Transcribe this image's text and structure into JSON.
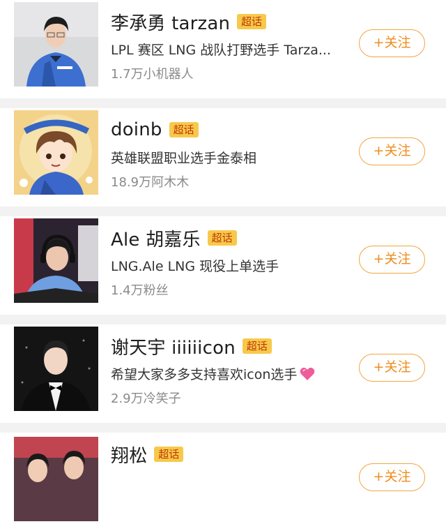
{
  "accounts": [
    {
      "name": "李承勇 tarzan",
      "badge": "超话",
      "desc": "LPL 赛区 LNG 战队打野选手 Tarza...",
      "fans": "1.7万小机器人",
      "follow": "+关注",
      "avatar_icon": "player-photo-jersey"
    },
    {
      "name": "doinb",
      "badge": "超话",
      "desc": "英雄联盟职业选手金泰相",
      "fans": "18.9万阿木木",
      "follow": "+关注",
      "avatar_icon": "cartoon-avatar"
    },
    {
      "name": "Ale 胡嘉乐",
      "badge": "超话",
      "desc": "LNG.Ale  LNG 现役上单选手",
      "fans": "1.4万粉丝",
      "follow": "+关注",
      "avatar_icon": "player-photo-headset"
    },
    {
      "name": "谢天宇 iiiiiicon",
      "badge": "超话",
      "desc": "希望大家多多支持喜欢icon选手",
      "fans": "2.9万冷笑子",
      "follow": "+关注",
      "avatar_icon": "player-photo-tuxedo",
      "desc_emoji": "pink-heart-icon"
    },
    {
      "name": "翔松",
      "badge": "超话",
      "desc": "",
      "fans": "",
      "follow": "+关注",
      "avatar_icon": "player-photo-duo"
    }
  ],
  "colors": {
    "badge_bg": "#f7c94b",
    "badge_text": "#c03a05",
    "follow_border": "#f0a640",
    "follow_text": "#f08b1b"
  }
}
